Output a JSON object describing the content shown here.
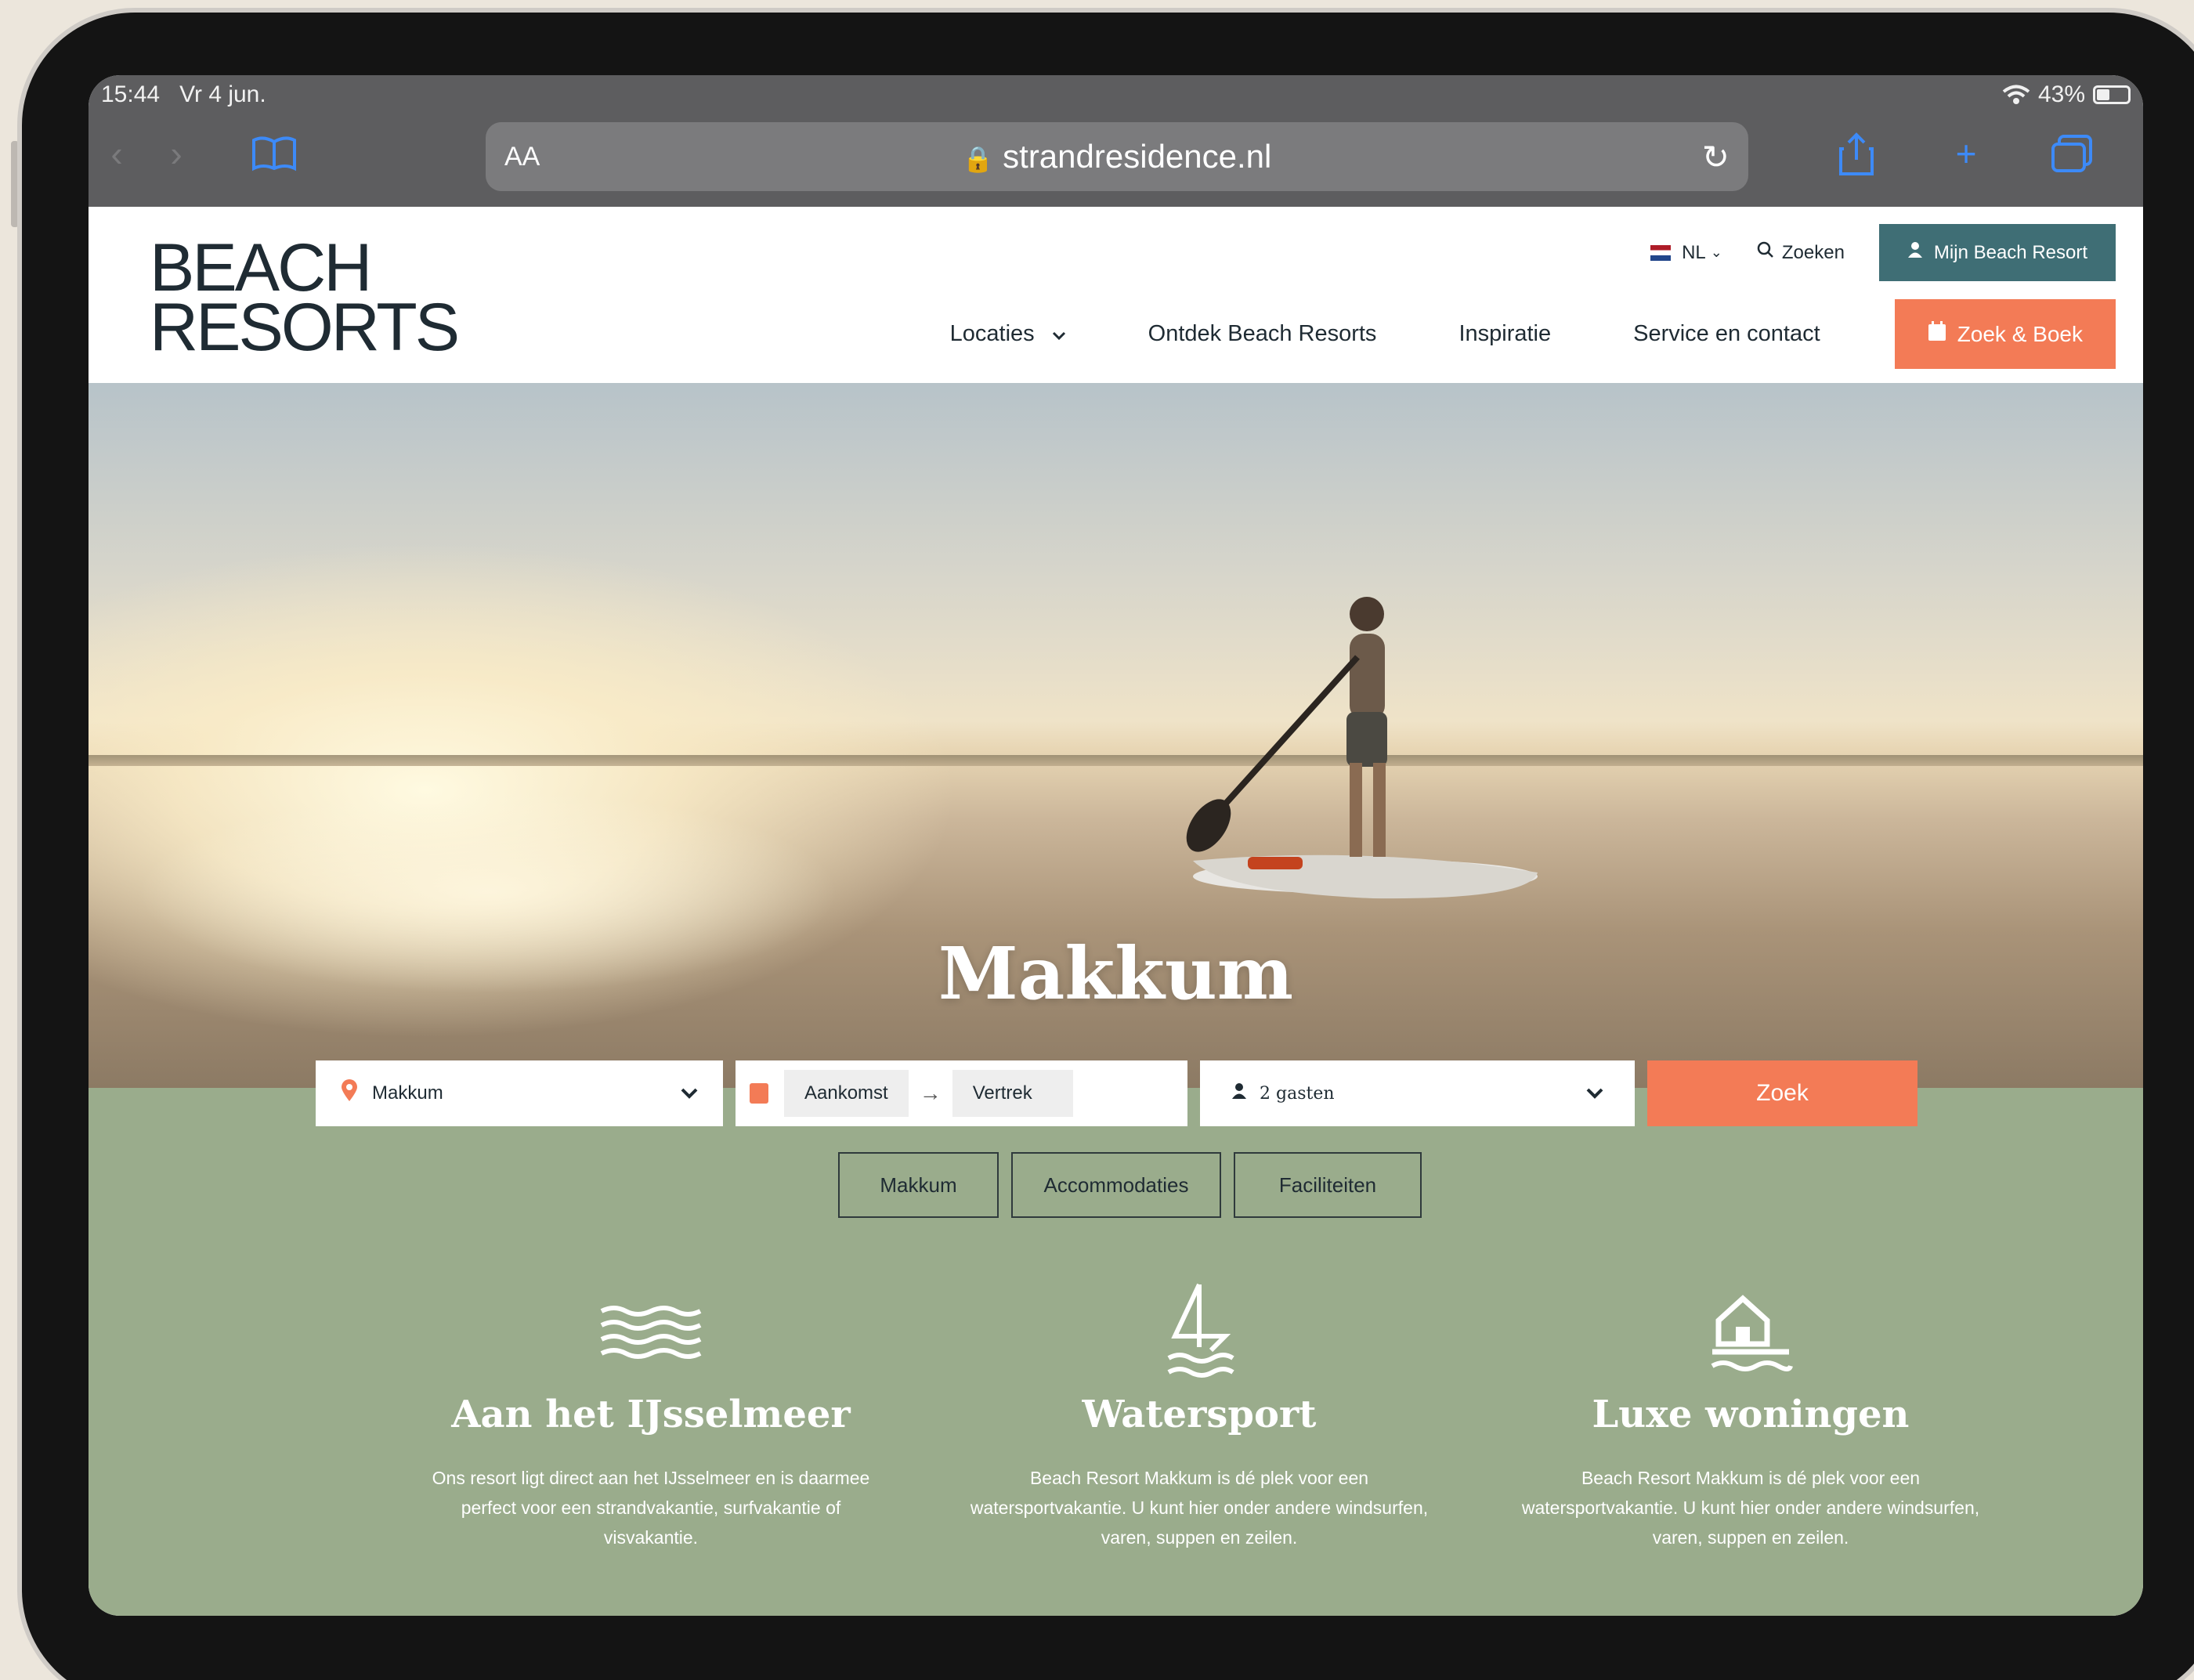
{
  "status": {
    "time": "15:44",
    "date": "Vr 4 jun.",
    "battery": "43%"
  },
  "browser": {
    "text_size": "AA",
    "url": "strandresidence.nl"
  },
  "site": {
    "logo_line1": "BEACH",
    "logo_line2": "RESORTS",
    "lang": "NL",
    "search_label": "Zoeken",
    "account_label": "Mijn Beach Resort",
    "nav": [
      "Locaties",
      "Ontdek Beach Resorts",
      "Inspiratie",
      "Service en contact"
    ],
    "book_label": "Zoek & Boek"
  },
  "hero": {
    "title": "Makkum"
  },
  "search": {
    "location": "Makkum",
    "arrival": "Aankomst",
    "arrow": "→",
    "departure": "Vertrek",
    "guests": "2 gasten",
    "submit": "Zoek"
  },
  "tabs": [
    "Makkum",
    "Accommodaties",
    "Faciliteiten"
  ],
  "features": [
    {
      "icon": "waves-icon",
      "title": "Aan het IJsselmeer",
      "text": "Ons resort ligt direct aan het IJsselmeer en is daarmee perfect voor een strandvakantie, surfvakantie of visvakantie."
    },
    {
      "icon": "sailboat-icon",
      "title": "Watersport",
      "text": "Beach Resort Makkum is dé plek voor een watersportvakantie. U kunt hier onder andere windsurfen, varen, suppen en zeilen."
    },
    {
      "icon": "house-icon",
      "title": "Luxe woningen",
      "text": "Beach Resort Makkum is dé plek voor een watersportvakantie. U kunt hier onder andere windsurfen, varen, suppen en zeilen."
    }
  ],
  "colors": {
    "accent": "#f37b56",
    "account": "#3f6e75",
    "green": "#9aac8c",
    "navy": "#1f2b33"
  }
}
